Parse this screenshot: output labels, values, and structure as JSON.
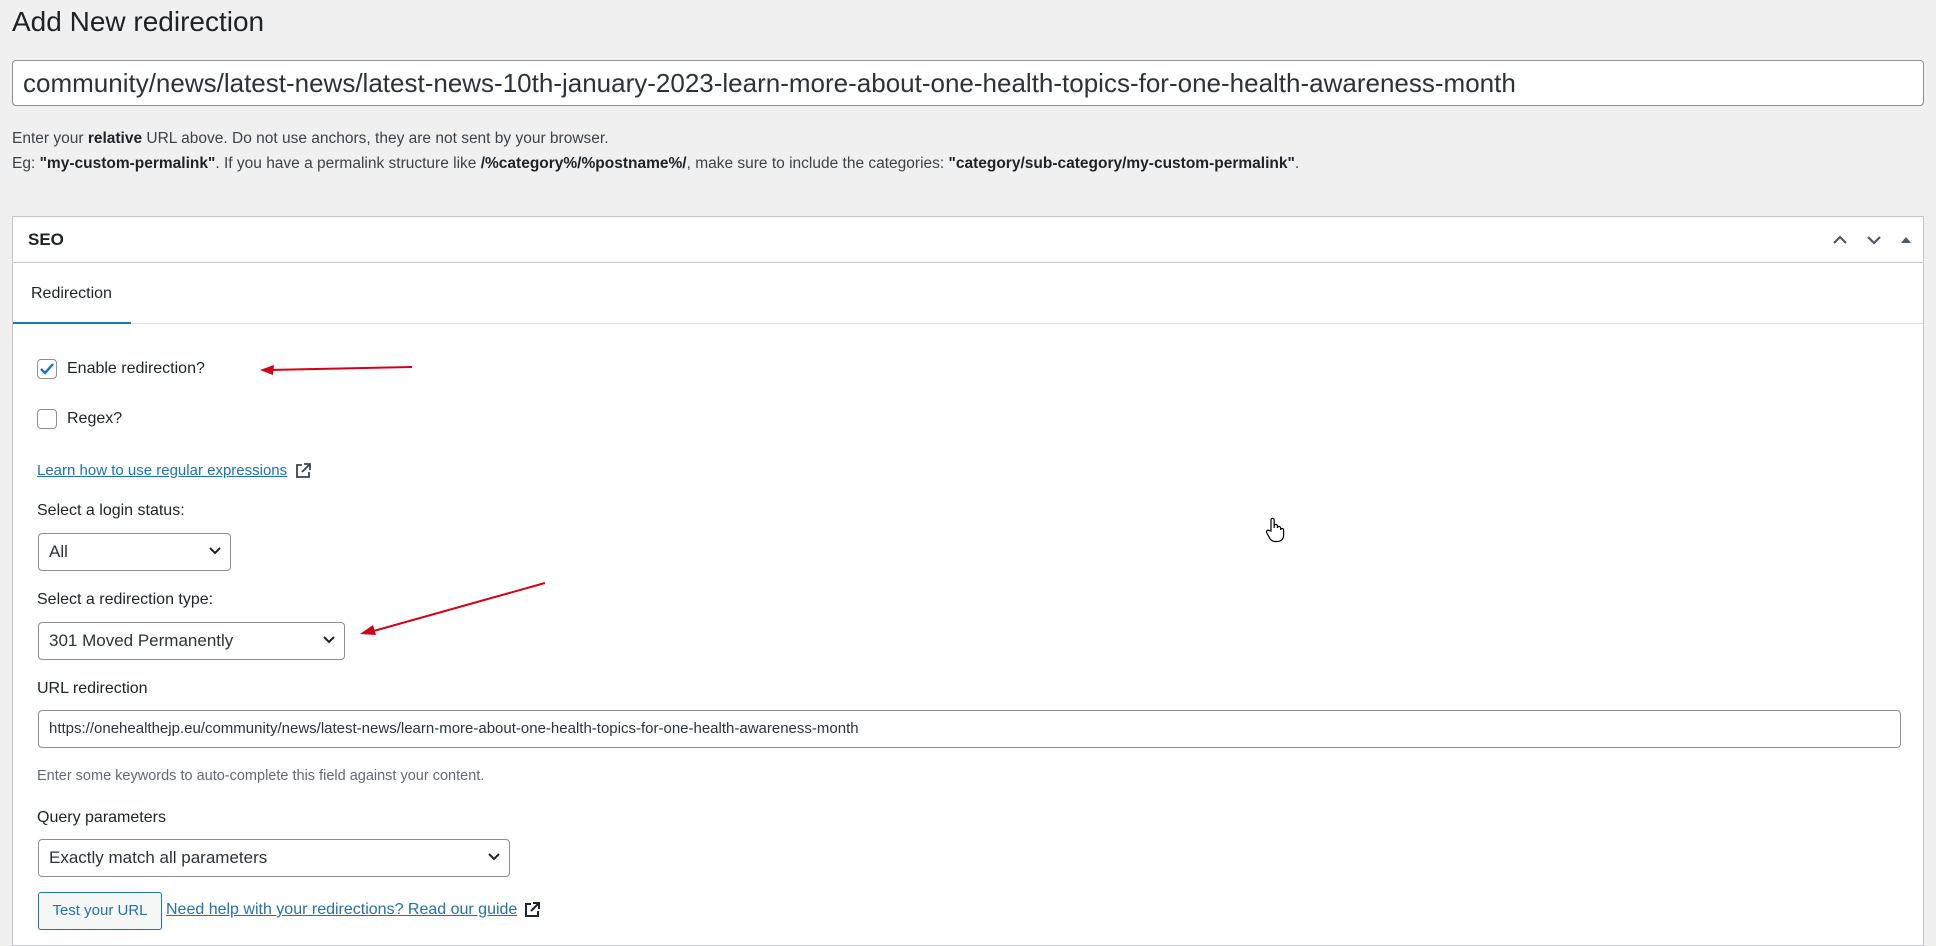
{
  "page": {
    "title": "Add New redirection",
    "url_value": "community/news/latest-news/latest-news-10th-january-2023-learn-more-about-one-health-topics-for-one-health-awareness-month"
  },
  "help": {
    "line1_prefix": "Enter your ",
    "line1_bold": "relative",
    "line1_suffix": " URL above. Do not use anchors, they are not sent by your browser.",
    "line2_a": "Eg: ",
    "line2_b": "\"my-custom-permalink\"",
    "line2_c": ". If you have a permalink structure like ",
    "line2_d": "/%category%/%postname%/",
    "line2_e": ", make sure to include the categories: ",
    "line2_f": "\"category/sub-category/my-custom-permalink\"",
    "line2_g": "."
  },
  "seo_box": {
    "title": "SEO",
    "tab_label": "Redirection",
    "enable_label": "Enable redirection?",
    "enable_checked": true,
    "regex_label": "Regex?",
    "regex_checked": false,
    "learn_link": "Learn how to use regular expressions",
    "login_status_label": "Select a login status:",
    "login_status_value": "All",
    "redirection_type_label": "Select a redirection type:",
    "redirection_type_value": "301 Moved Permanently",
    "url_redirection_label": "URL redirection",
    "url_redirection_value": "https://onehealthejp.eu/community/news/latest-news/learn-more-about-one-health-topics-for-one-health-awareness-month",
    "url_redirection_desc": "Enter some keywords to auto-complete this field against your content.",
    "query_params_label": "Query parameters",
    "query_params_value": "Exactly match all parameters",
    "test_button": "Test your URL",
    "guide_link": "Need help with your redirections? Read our guide"
  },
  "colors": {
    "accent": "#2271b1",
    "annotation_arrow": "#d0021b",
    "background": "#f0f0f1"
  },
  "icons": [
    "chevron-up-icon",
    "chevron-down-icon",
    "caret-up-icon",
    "checkmark-icon",
    "external-link-icon",
    "hand-cursor-icon"
  ]
}
